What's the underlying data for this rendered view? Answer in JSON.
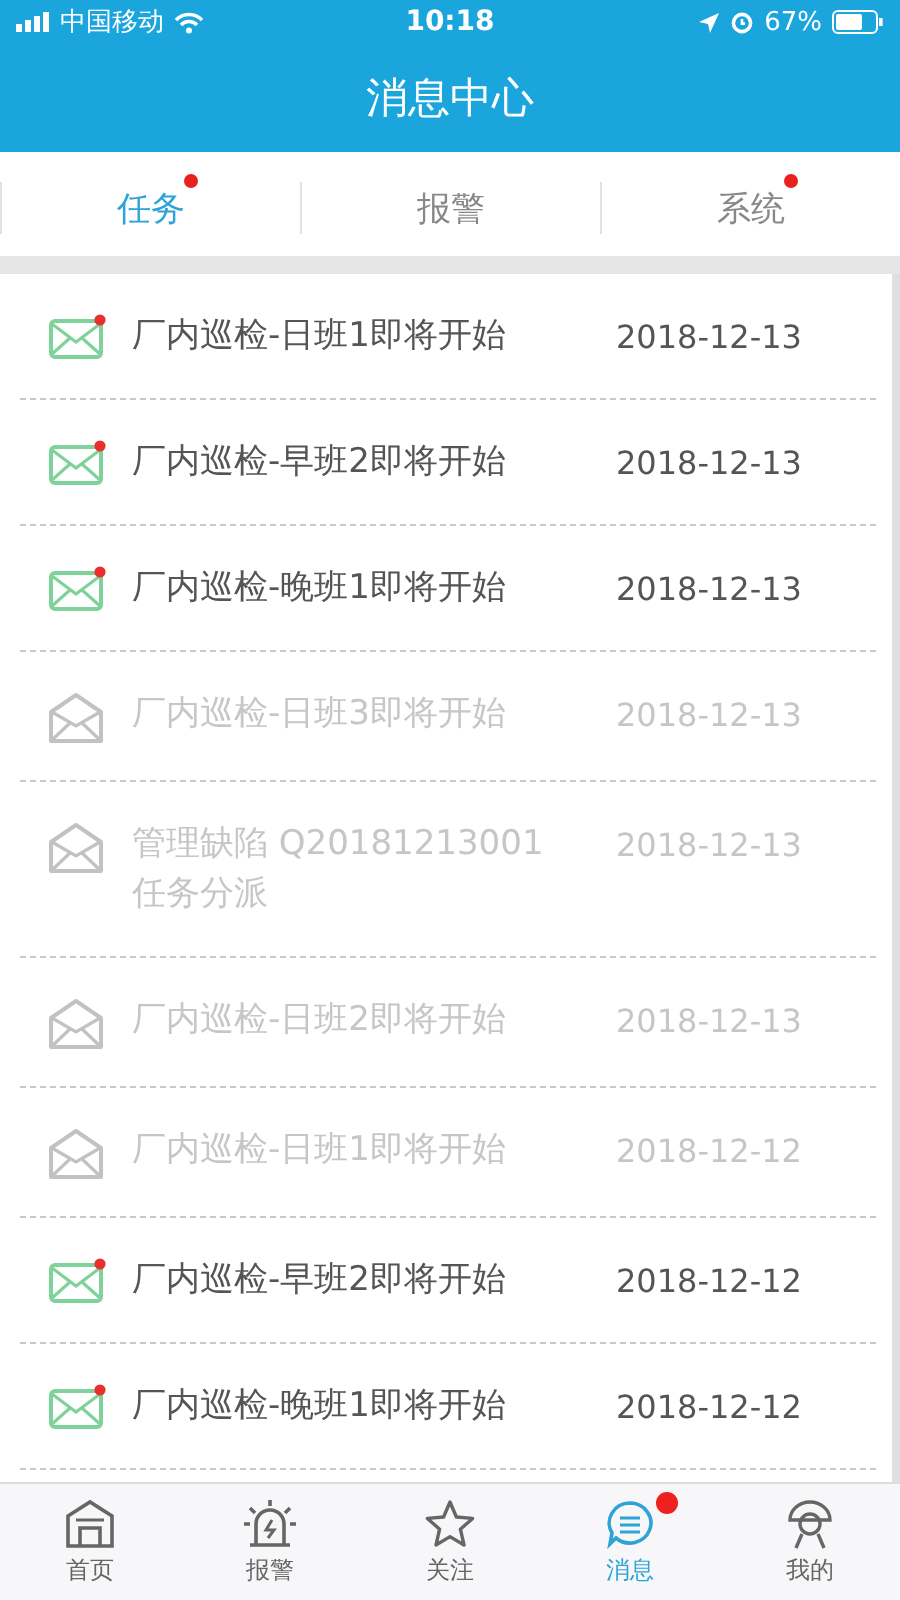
{
  "status_bar": {
    "carrier": "中国移动",
    "time": "10:18",
    "battery": "67%"
  },
  "title": "消息中心",
  "tabs": [
    {
      "label": "任务",
      "selected": true,
      "badge": true
    },
    {
      "label": "报警",
      "selected": false,
      "badge": false
    },
    {
      "label": "系统",
      "selected": false,
      "badge": true
    }
  ],
  "messages": [
    {
      "title": "厂内巡检-日班1即将开始",
      "date": "2018-12-13",
      "unread": true
    },
    {
      "title": "厂内巡检-早班2即将开始",
      "date": "2018-12-13",
      "unread": true
    },
    {
      "title": "厂内巡检-晚班1即将开始",
      "date": "2018-12-13",
      "unread": true
    },
    {
      "title": "厂内巡检-日班3即将开始",
      "date": "2018-12-13",
      "unread": false
    },
    {
      "title": "管理缺陷 Q20181213001 任务分派",
      "date": "2018-12-13",
      "unread": false
    },
    {
      "title": "厂内巡检-日班2即将开始",
      "date": "2018-12-13",
      "unread": false
    },
    {
      "title": "厂内巡检-日班1即将开始",
      "date": "2018-12-12",
      "unread": false
    },
    {
      "title": "厂内巡检-早班2即将开始",
      "date": "2018-12-12",
      "unread": true
    },
    {
      "title": "厂内巡检-晚班1即将开始",
      "date": "2018-12-12",
      "unread": true
    }
  ],
  "nav": [
    {
      "kind": "home",
      "label": "首页",
      "selected": false,
      "badge": false
    },
    {
      "kind": "alarm",
      "label": "报警",
      "selected": false,
      "badge": false
    },
    {
      "kind": "star",
      "label": "关注",
      "selected": false,
      "badge": false
    },
    {
      "kind": "message",
      "label": "消息",
      "selected": true,
      "badge": true
    },
    {
      "kind": "profile",
      "label": "我的",
      "selected": false,
      "badge": false
    }
  ]
}
